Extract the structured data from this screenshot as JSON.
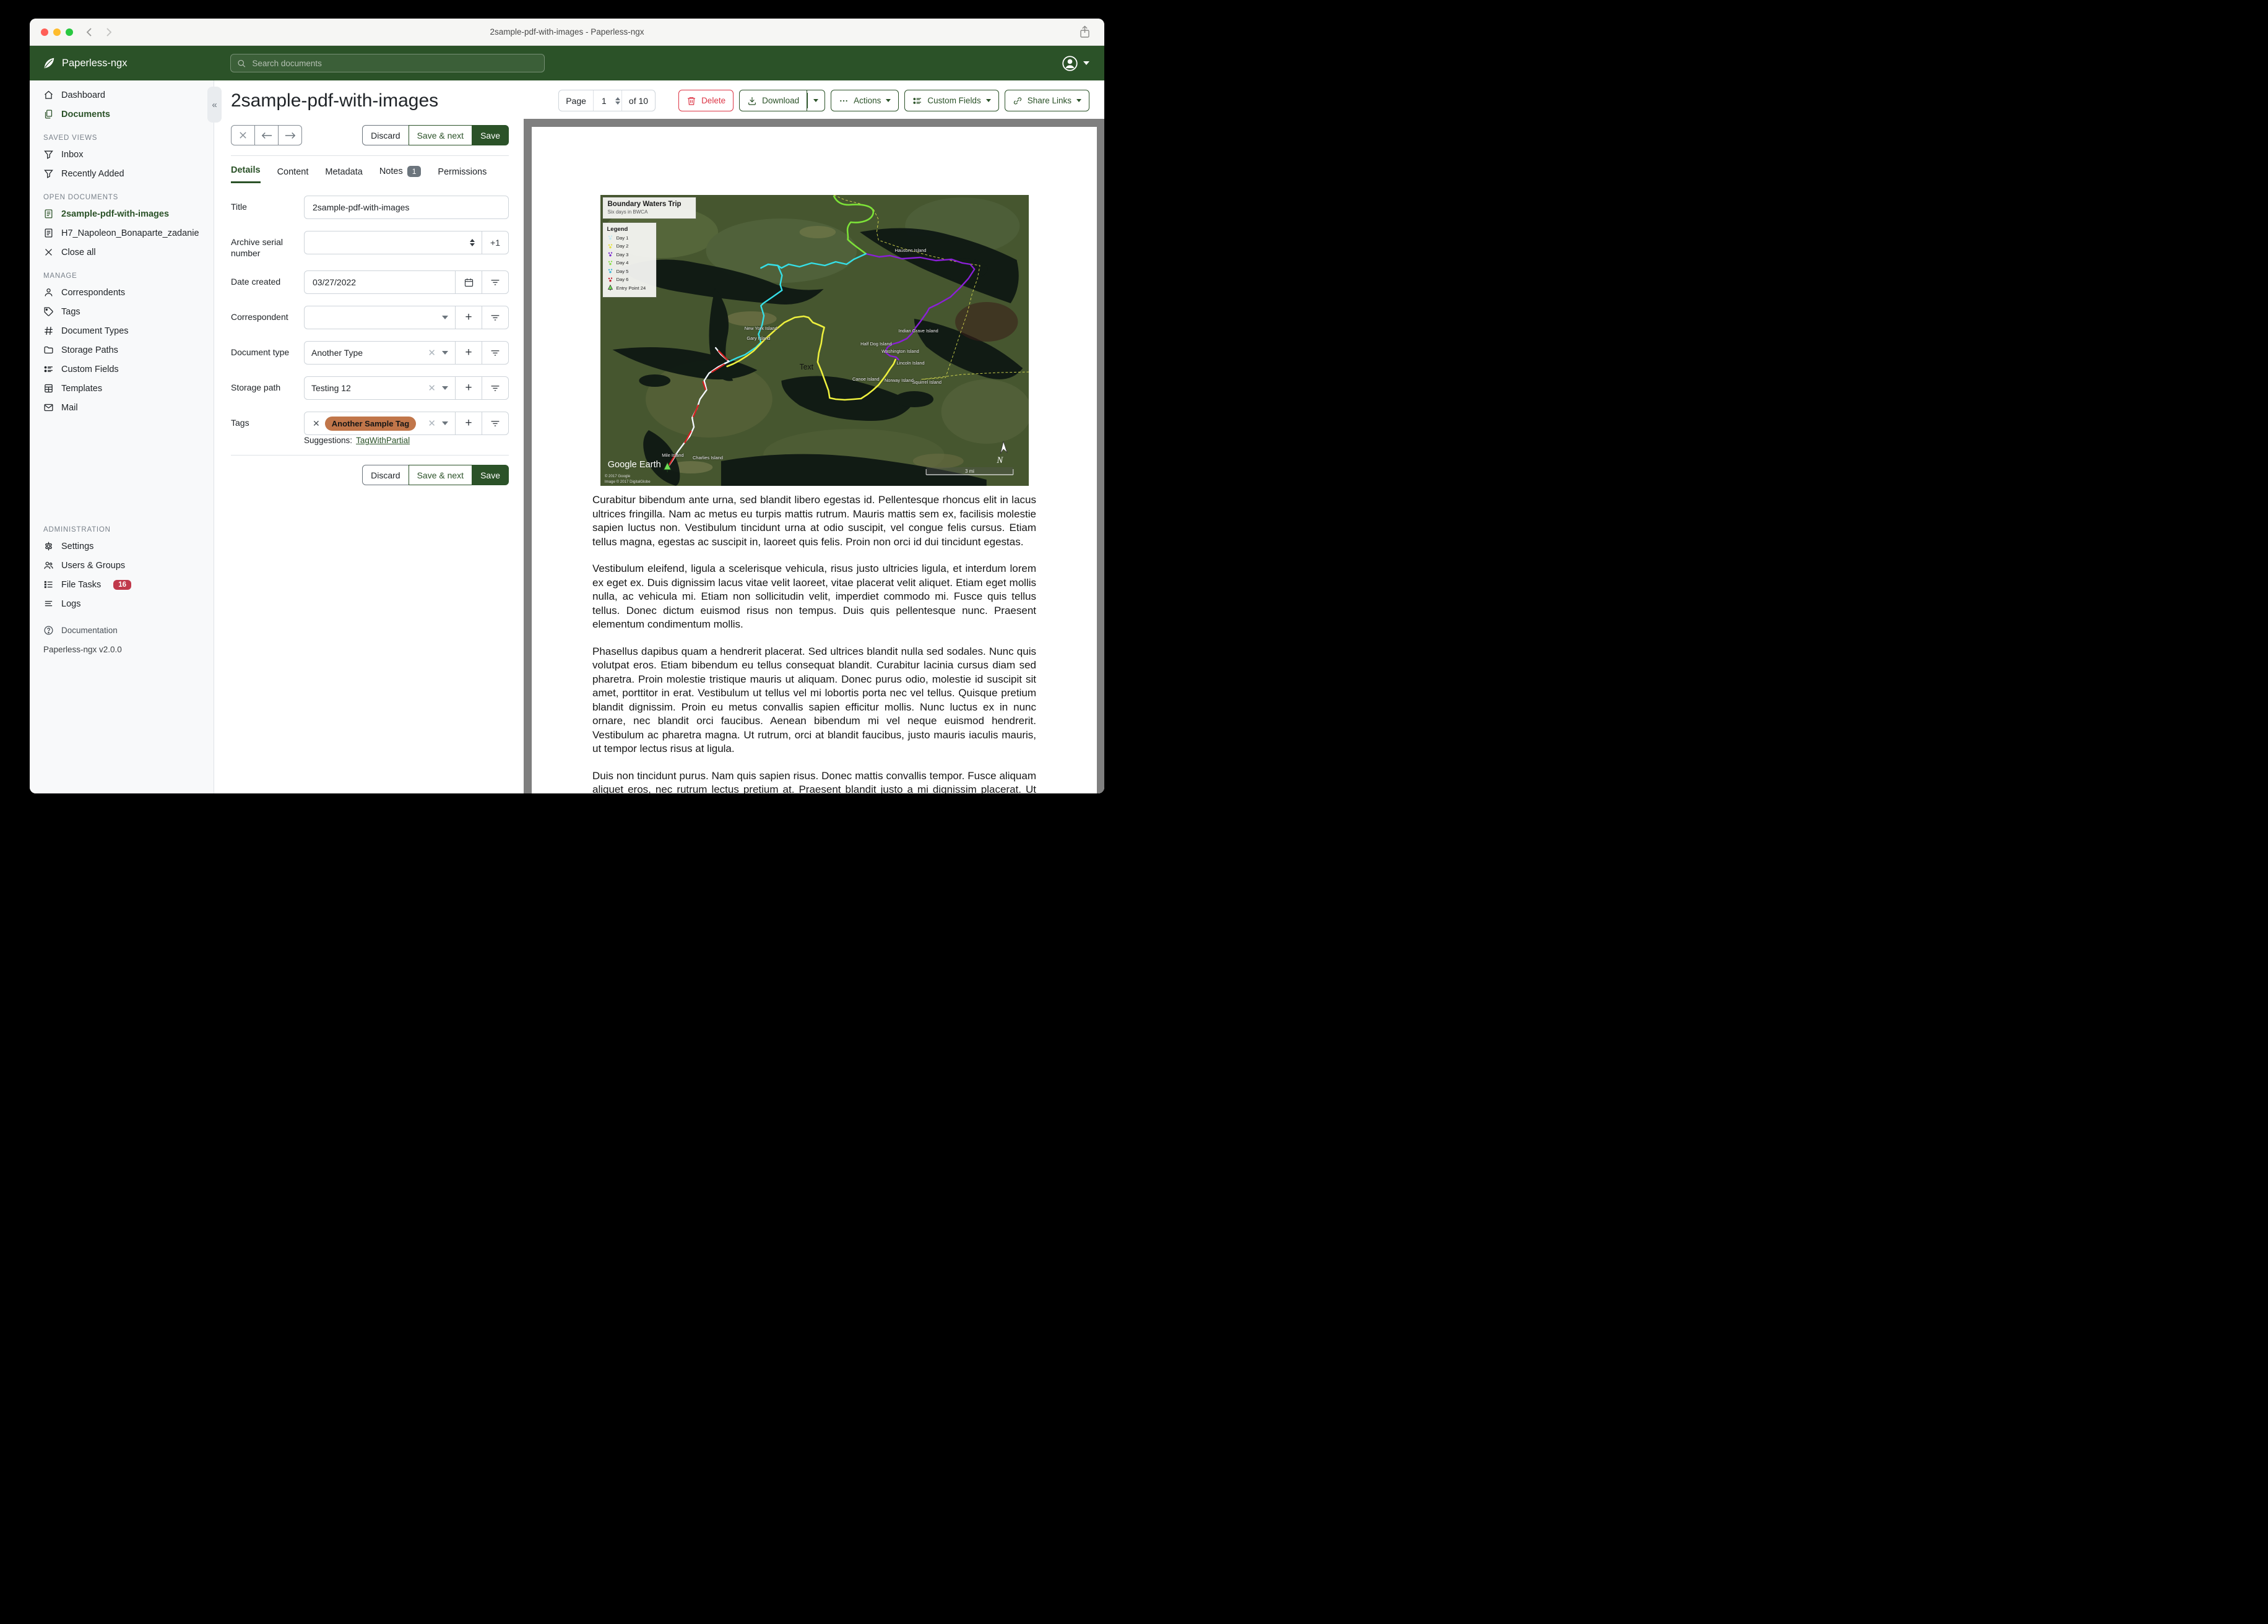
{
  "window": {
    "title": "2sample-pdf-with-images - Paperless-ngx"
  },
  "header": {
    "app_name": "Paperless-ngx",
    "search_placeholder": "Search documents"
  },
  "colors": {
    "brand_green": "#2b5228",
    "delete_red": "#dc3545",
    "tag_chip": "#c1764a",
    "file_tasks_badge": "#c0394b",
    "notes_badge": "#6c757d"
  },
  "sidebar": {
    "items_top": [
      {
        "label": "Dashboard",
        "icon": "home",
        "active": false
      },
      {
        "label": "Documents",
        "icon": "files",
        "active": true
      }
    ],
    "sections": [
      {
        "title": "SAVED VIEWS",
        "items": [
          {
            "label": "Inbox",
            "icon": "funnel"
          },
          {
            "label": "Recently Added",
            "icon": "funnel"
          }
        ]
      },
      {
        "title": "OPEN DOCUMENTS",
        "items": [
          {
            "label": "2sample-pdf-with-images",
            "icon": "doc",
            "active": true
          },
          {
            "label": "H7_Napoleon_Bonaparte_zadanie",
            "icon": "doc"
          },
          {
            "label": "Close all",
            "icon": "x"
          }
        ]
      },
      {
        "title": "MANAGE",
        "items": [
          {
            "label": "Correspondents",
            "icon": "person"
          },
          {
            "label": "Tags",
            "icon": "tag"
          },
          {
            "label": "Document Types",
            "icon": "hash"
          },
          {
            "label": "Storage Paths",
            "icon": "folder"
          },
          {
            "label": "Custom Fields",
            "icon": "fields"
          },
          {
            "label": "Templates",
            "icon": "template"
          },
          {
            "label": "Mail",
            "icon": "mail"
          }
        ]
      },
      {
        "title": "ADMINISTRATION",
        "items": [
          {
            "label": "Settings",
            "icon": "gear"
          },
          {
            "label": "Users & Groups",
            "icon": "users"
          },
          {
            "label": "File Tasks",
            "icon": "tasks",
            "badge": "16"
          },
          {
            "label": "Logs",
            "icon": "logs"
          }
        ]
      }
    ],
    "footer": {
      "documentation": "Documentation",
      "version": "Paperless-ngx v2.0.0"
    }
  },
  "toolbar": {
    "page_label": "Page",
    "page_value": "1",
    "page_total": "of 10",
    "delete_label": "Delete",
    "download_label": "Download",
    "actions_label": "Actions",
    "custom_fields_label": "Custom Fields",
    "share_links_label": "Share Links"
  },
  "doc": {
    "title": "2sample-pdf-with-images",
    "save_buttons": {
      "discard": "Discard",
      "save_next": "Save & next",
      "save": "Save"
    },
    "tabs": [
      {
        "label": "Details",
        "active": true
      },
      {
        "label": "Content"
      },
      {
        "label": "Metadata"
      },
      {
        "label": "Notes",
        "badge": "1"
      },
      {
        "label": "Permissions"
      }
    ],
    "fields": {
      "title": {
        "label": "Title",
        "value": "2sample-pdf-with-images"
      },
      "asn": {
        "label": "Archive serial number",
        "value": "",
        "plus_one": "+1"
      },
      "date_created": {
        "label": "Date created",
        "value": "03/27/2022"
      },
      "correspondent": {
        "label": "Correspondent",
        "value": ""
      },
      "document_type": {
        "label": "Document type",
        "value": "Another Type"
      },
      "storage_path": {
        "label": "Storage path",
        "value": "Testing 12"
      },
      "tags": {
        "label": "Tags",
        "chip": "Another Sample Tag",
        "chip_color": "#c1764a"
      },
      "suggestions_label": "Suggestions:",
      "suggestions": [
        {
          "label": "TagWithPartial"
        }
      ]
    }
  },
  "preview": {
    "map": {
      "title": "Boundary Waters Trip",
      "subtitle": "Six days in BWCA",
      "legend_title": "Legend",
      "legend_items": [
        {
          "label": "Day 1",
          "color": "#c2e8f0"
        },
        {
          "label": "Day 2",
          "color": "#e6e23c"
        },
        {
          "label": "Day 3",
          "color": "#7b2bd0"
        },
        {
          "label": "Day 4",
          "color": "#8ade4c"
        },
        {
          "label": "Day 5",
          "color": "#43b6d8"
        },
        {
          "label": "Day 6",
          "color": "#c42030"
        },
        {
          "label": "Entry Point 24",
          "color": "#6fdd55"
        }
      ],
      "island_labels": [
        "Hausons Island",
        "New York Island",
        "Gary Island",
        "Indian Grave Island",
        "Half Dog Island",
        "Washington Island",
        "Lincoln Island",
        "Canoe Island",
        "Norway Island",
        "Squirrel Island",
        "Mile Island",
        "Charlies Island"
      ],
      "text_annotation": "Text",
      "attribution": {
        "logo": "Google Earth",
        "line1": "© 2017 Google",
        "line2": "Image © 2017 DigitalGlobe"
      },
      "scale_label": "3 mi",
      "compass": "N"
    },
    "paragraphs": [
      "Curabitur bibendum ante urna, sed blandit libero egestas id. Pellentesque rhoncus elit in lacus ultrices fringilla. Nam ac metus eu turpis mattis rutrum. Mauris mattis sem ex, facilisis molestie sapien luctus non. Vestibulum tincidunt urna at odio suscipit, vel congue felis cursus. Etiam tellus magna, egestas ac suscipit in, laoreet quis felis. Proin non orci id dui tincidunt egestas.",
      "Vestibulum eleifend, ligula a scelerisque vehicula, risus justo ultricies ligula, et interdum lorem ex eget ex. Duis dignissim lacus vitae velit laoreet, vitae placerat velit aliquet. Etiam eget mollis nulla, ac vehicula mi. Etiam non sollicitudin velit, imperdiet commodo mi. Fusce quis tellus tellus. Donec dictum euismod risus non tempus. Duis quis pellentesque nunc. Praesent elementum condimentum mollis.",
      "Phasellus dapibus quam a hendrerit placerat. Sed ultrices blandit nulla sed sodales. Nunc quis volutpat eros. Etiam bibendum eu tellus consequat blandit. Curabitur lacinia cursus diam sed pharetra. Proin molestie tristique mauris ut aliquam. Donec purus odio, molestie id suscipit sit amet, porttitor in erat. Vestibulum ut tellus vel mi lobortis porta nec vel tellus. Quisque pretium blandit dignissim. Proin eu metus convallis sapien efficitur mollis. Nunc luctus ex in nunc ornare, nec blandit orci faucibus. Aenean bibendum mi vel neque euismod hendrerit. Vestibulum ac pharetra magna. Ut rutrum, orci at blandit faucibus, justo mauris iaculis mauris, ut tempor lectus risus at ligula.",
      "Duis non tincidunt purus. Nam quis sapien risus. Donec mattis convallis tempor. Fusce aliquam aliquet eros, nec rutrum lectus pretium at. Praesent blandit justo a mi dignissim placerat. Ut ullamcorper elit eget diam maximus iaculis. In bibendum in massa eget facilisis. In iaculis lectus"
    ]
  }
}
